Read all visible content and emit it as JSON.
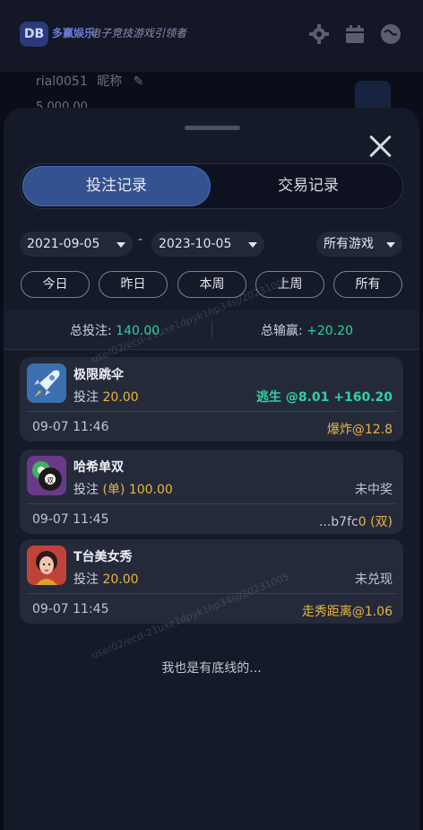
{
  "background": {
    "brand": "多赢娱乐",
    "slogan": "电子竞技游戏引领者",
    "username": "rial0051",
    "nickname_label": "昵称",
    "balance": "5,000.00"
  },
  "modal": {
    "tabs": [
      {
        "label": "投注记录",
        "active": true
      },
      {
        "label": "交易记录",
        "active": false
      }
    ],
    "filters": {
      "start_date": "2021-09-05",
      "separator": "-",
      "end_date": "2023-10-05",
      "game_select": "所有游戏",
      "quick_ranges": [
        "今日",
        "昨日",
        "本周",
        "上周",
        "所有"
      ]
    },
    "summary": {
      "total_bet_label": "总投注:",
      "total_bet_value": "140.00",
      "total_win_label": "总输赢:",
      "total_win_value": "+20.20"
    },
    "records": [
      {
        "game": "极限跳伞",
        "bet_label": "投注",
        "bet_value": "20.00",
        "result": "逃生 @8.01 +160.20",
        "time": "09-07 11:46",
        "detail": "爆炸@12.8"
      },
      {
        "game": "哈希单双",
        "bet_label": "投注",
        "bet_value": "(单) 100.00",
        "result": "未中奖",
        "time": "09-07 11:45",
        "detail_prefix": "...b7fc",
        "detail_highlight": "0 (双)"
      },
      {
        "game": "T台美女秀",
        "bet_label": "投注",
        "bet_value": "20.00",
        "result": "未兑现",
        "time": "09-07 11:45",
        "detail": "走秀距离@1.06"
      }
    ],
    "footer_text": "我也是有底线的..."
  },
  "watermark": "user02/ecd-21uxe1dpyk1hp34sj/20231005",
  "colors": {
    "accent_blue": "#34528f",
    "win_green": "#2fd1a0",
    "highlight_yellow": "#e8b53a"
  },
  "icons": [
    "gear-icon",
    "calendar-icon",
    "globe-icon",
    "pencil-icon",
    "close-icon",
    "caret-down-icon",
    "rocket-icon",
    "billiard-ball-icon",
    "woman-portrait-icon"
  ]
}
